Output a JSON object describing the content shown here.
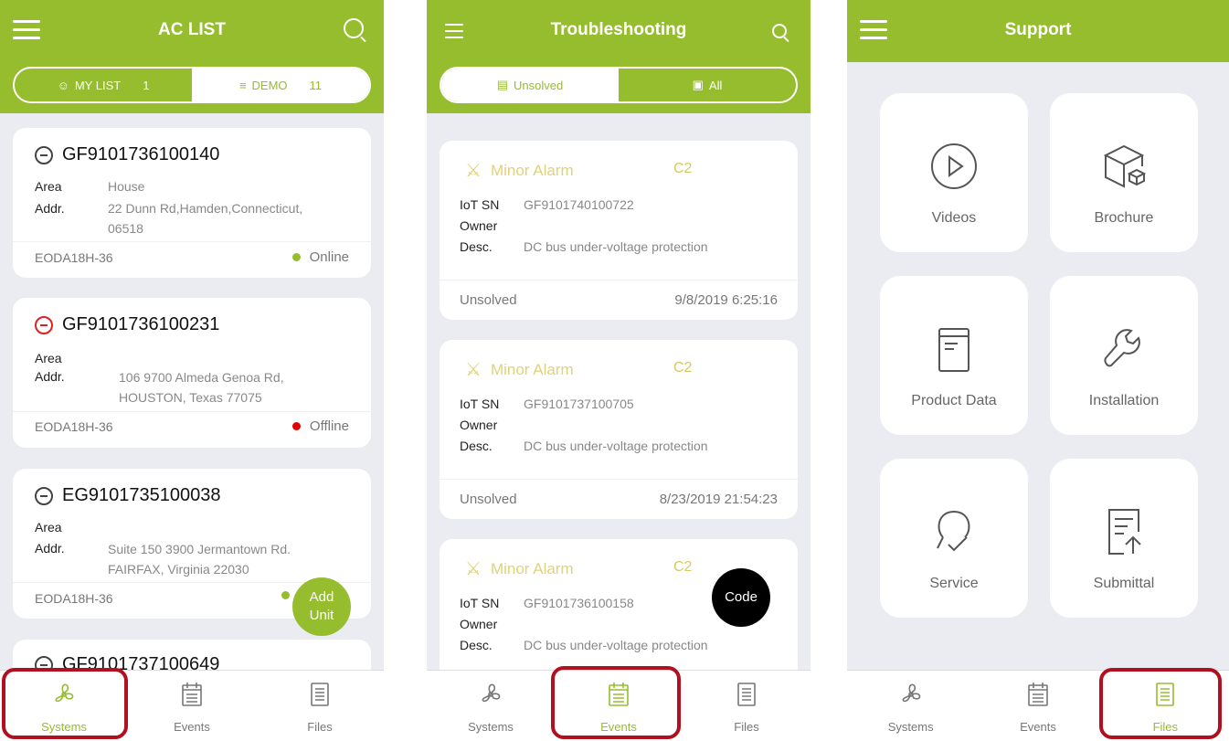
{
  "colors": {
    "accent": "#96bd2e",
    "highlight": "#b01020",
    "online": "#96bd2e",
    "offline": "#e00000",
    "alarm": "#e0d278"
  },
  "screen1": {
    "title": "AC LIST",
    "tabs": {
      "mine_label": "MY LIST",
      "mine_count": "1",
      "demo_label": "DEMO",
      "demo_count": "11"
    },
    "units": [
      {
        "id": "GF9101736100140",
        "area_label": "Area",
        "area": "House",
        "addr_label": "Addr.",
        "addr1": "22 Dunn Rd,Hamden,Connecticut,",
        "addr2": "06518",
        "model": "EODA18H-36",
        "status": "Online"
      },
      {
        "id": "GF9101736100231",
        "area_label": "Area",
        "area": "",
        "addr_label": "Addr.",
        "addr1": "106 9700 Almeda Genoa Rd,",
        "addr2": "HOUSTON, Texas 77075",
        "model": "EODA18H-36",
        "status": "Offline"
      },
      {
        "id": "EG9101735100038",
        "area_label": "Area",
        "area": "",
        "addr_label": "Addr.",
        "addr1": "Suite 150 3900  Jermantown Rd.",
        "addr2": "FAIRFAX, Virginia 22030",
        "model": "EODA18H-36",
        "status": ""
      },
      {
        "id": "GF9101737100649"
      }
    ],
    "fab_line1": "Add",
    "fab_line2": "Unit"
  },
  "screen2": {
    "title": "Troubleshooting",
    "tabs": {
      "unsolved_label": "Unsolved",
      "all_label": "All"
    },
    "alarms": [
      {
        "title": "Minor Alarm",
        "code": "C2",
        "sn_label": "IoT SN",
        "sn": "GF9101740100722",
        "owner_label": "Owner",
        "desc_label": "Desc.",
        "desc": "DC bus under-voltage protection",
        "state": "Unsolved",
        "time": "9/8/2019  6:25:16"
      },
      {
        "title": "Minor Alarm",
        "code": "C2",
        "sn_label": "IoT SN",
        "sn": "GF9101737100705",
        "owner_label": "Owner",
        "desc_label": "Desc.",
        "desc": "DC bus under-voltage protection",
        "state": "Unsolved",
        "time": "8/23/2019  21:54:23"
      },
      {
        "title": "Minor Alarm",
        "code": "C2",
        "sn_label": "IoT SN",
        "sn": "GF9101736100158",
        "owner_label": "Owner",
        "desc_label": "Desc.",
        "desc": "DC bus under-voltage protection"
      }
    ],
    "fab_label": "Code"
  },
  "screen3": {
    "title": "Support",
    "tiles": [
      "Videos",
      "Brochure",
      "Product Data",
      "Installation",
      "Service",
      "Submittal"
    ]
  },
  "tabbar": {
    "systems": "Systems",
    "events": "Events",
    "files": "Files"
  }
}
